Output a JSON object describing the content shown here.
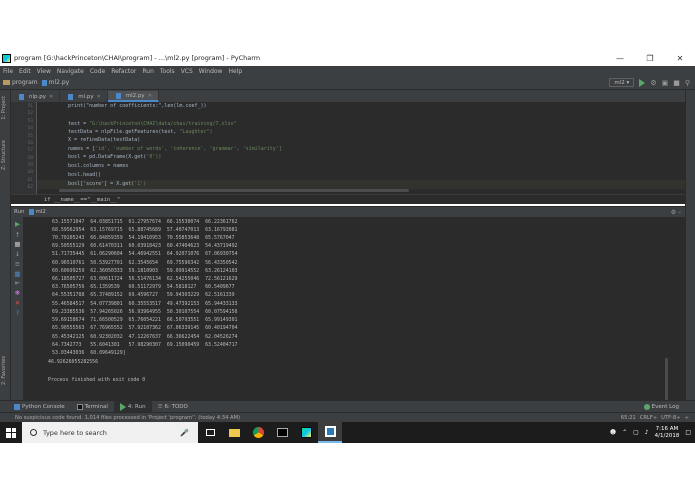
{
  "window": {
    "title": "program [G:\\hackPrinceton\\CHAI\\program] - ...\\ml2.py [program] - PyCharm",
    "minimize": "—",
    "maximize": "❐",
    "close": "✕"
  },
  "menu": [
    "File",
    "Edit",
    "View",
    "Navigate",
    "Code",
    "Refactor",
    "Run",
    "Tools",
    "VCS",
    "Window",
    "Help"
  ],
  "nav": {
    "project": "program",
    "file": "ml2.py",
    "run_config": "ml2 ▾"
  },
  "side_tabs": {
    "project": "1: Project",
    "structure": "Z: Structure",
    "favorites": "2: Favorites"
  },
  "editor": {
    "tabs": [
      {
        "label": "nlp.py",
        "active": false
      },
      {
        "label": "ml.py",
        "active": false
      },
      {
        "label": "ml2.py",
        "active": true
      }
    ],
    "line_numbers": [
      "51",
      "52",
      "53",
      "54",
      "55",
      "56",
      "57",
      "58",
      "59",
      "60",
      "61",
      "62",
      "63"
    ],
    "code": [
      {
        "plain": "    print(\"number of coefficients:\",len(lm.coef_))",
        "str": ""
      },
      {
        "plain": "",
        "str": ""
      },
      {
        "plain": "    test = ",
        "str": "\"G:\\hackPrinceton\\CHAI\\data/chai/training/7.xlsx\""
      },
      {
        "plain": "    testData = nlpFile.getFeatures(test, ",
        "str": "\"Laughter\")"
      },
      {
        "plain": "    X = refineData(testData)",
        "str": ""
      },
      {
        "plain": "    names = [",
        "str": "'id', 'number of words', 'coherence', 'grammar', 'similarity']"
      },
      {
        "plain": "    bosl = pd.DataFrame(X.get(",
        "str": "'0'))"
      },
      {
        "plain": "    bosl.columns = names",
        "str": ""
      },
      {
        "plain": "    bosl.head()",
        "str": ""
      },
      {
        "plain": "    bosl['score'] = X.get(",
        "str": "'1')"
      }
    ],
    "breadcrumb": "if __name__==\"__main__\""
  },
  "run": {
    "header_label": "Run",
    "config": "ml2",
    "gear": "⚙ –",
    "output_rows": [
      "63.15571047  64.03851715  61.27957674  66.15530074  66.22361762",
      "68.59562954  63.15769715  65.88745689  57.40747013  63.16793081",
      "70.70205243  66.84859359  54.19410953  70.55853648  65.5767047",
      "69.50555129  60.61470311  60.03918423  60.47404623  54.43719492",
      "51.71735445  61.06290604  54.46942551  64.92071076  67.06930754",
      "60.96510761  50.53927701  62.3545654   69.75596342  56.43350542",
      "60.60699259  62.36050333  59.1810903   59.09914552  63.26124103",
      "66.18505727  63.00611724  56.51476134  62.54255046  72.56121629",
      "63.76505756  65.1359539   60.51172979  54.5818127   60.5409677",
      "64.55351788  65.37489152  69.4596727   59.94303229  62.5161339",
      "55.46584517  54.07739801  60.35553517  49.47392153  65.94433133",
      "69.23385536  57.94265026  56.93964955  50.30107554  60.07594156",
      "59.69158674  71.66500529  65.76054221  66.50793551  65.99149301",
      "65.90555563  67.76965552  57.92107362  67.06339145  60.40194704",
      "65.45342125  60.92302032  47.12267637  66.36622454  62.04526274",
      "64.7342773   55.6041301   57.98290307  69.15090459  63.52404717",
      "53.03443036  60.09649129]"
    ],
    "final_value": "46.92626055282556",
    "finished": "Process finished with exit code 0"
  },
  "tool_tabs": {
    "python_console": "Python Console",
    "terminal": "Terminal",
    "run": "4: Run",
    "todo": "6: TODO",
    "event_log": "Event Log"
  },
  "status": {
    "message": "No suspicious code found. 1,014 files processed in 'Project 'program''. (today 4:34 AM)",
    "position": "65:21",
    "line_sep": "CRLF÷",
    "encoding": "UTF-8÷",
    "lock": "÷"
  },
  "taskbar": {
    "search_placeholder": "Type here to search",
    "time": "7:16 AM",
    "date": "4/1/2018"
  }
}
